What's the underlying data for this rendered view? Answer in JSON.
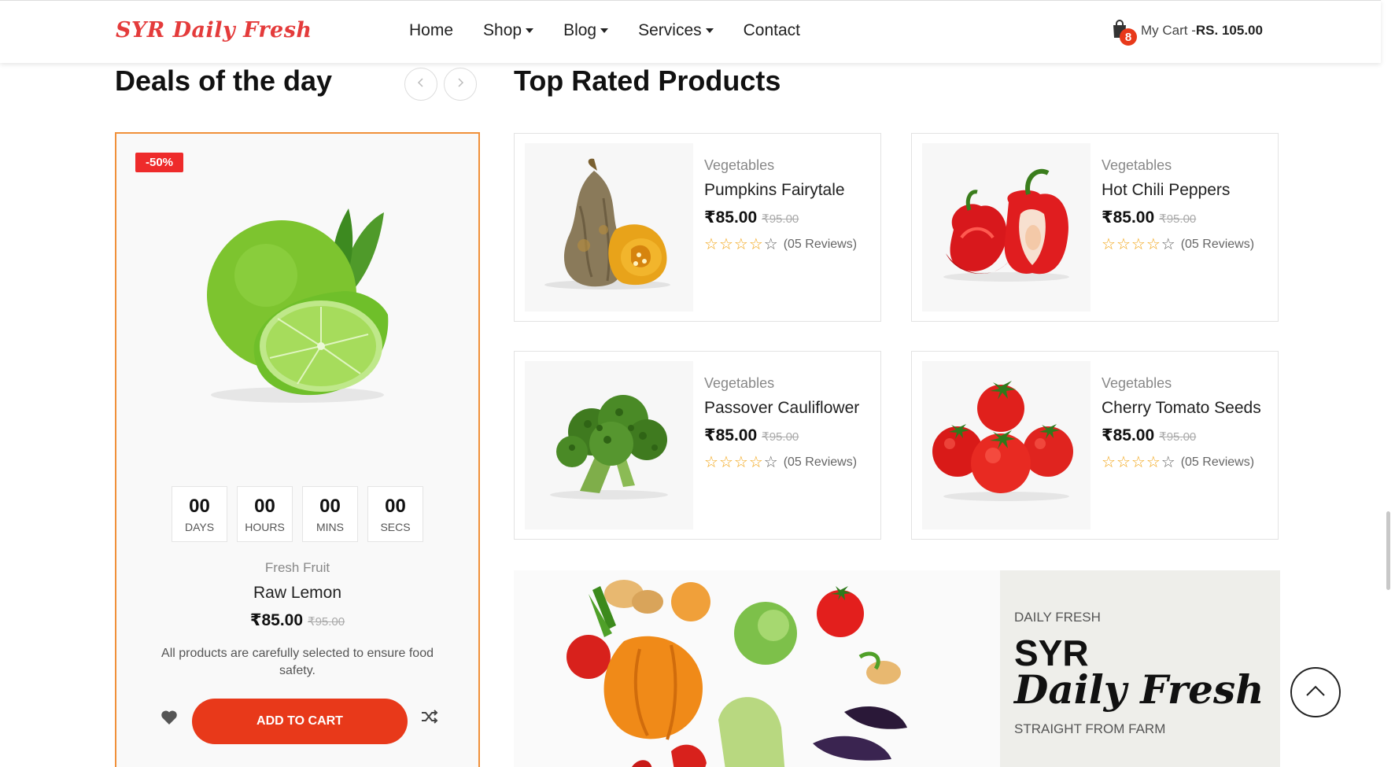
{
  "header": {
    "logo": "SYR Daily Fresh",
    "nav": [
      "Home",
      "Shop",
      "Blog",
      "Services",
      "Contact"
    ],
    "cart": {
      "count": "8",
      "label": "My Cart -",
      "total": "RS. 105.00"
    }
  },
  "deals": {
    "title": "Deals of the day",
    "badge": "-50%",
    "countdown": [
      {
        "value": "00",
        "label": "DAYS"
      },
      {
        "value": "00",
        "label": "HOURS"
      },
      {
        "value": "00",
        "label": "MINS"
      },
      {
        "value": "00",
        "label": "SECS"
      }
    ],
    "category": "Fresh Fruit",
    "name": "Raw Lemon",
    "price": "₹85.00",
    "old_price": "₹95.00",
    "description": "All products are carefully selected to ensure food safety.",
    "add_to_cart": "ADD TO CART"
  },
  "top_rated": {
    "title": "Top Rated Products",
    "products": [
      {
        "category": "Vegetables",
        "name": "Pumpkins Fairytale",
        "price": "₹85.00",
        "old_price": "₹95.00",
        "rating": 4,
        "reviews": "(05 Reviews)",
        "image": "pumpkin"
      },
      {
        "category": "Vegetables",
        "name": "Hot Chili Peppers",
        "price": "₹85.00",
        "old_price": "₹95.00",
        "rating": 4,
        "reviews": "(05 Reviews)",
        "image": "pepper"
      },
      {
        "category": "Vegetables",
        "name": "Passover Cauliflower",
        "price": "₹85.00",
        "old_price": "₹95.00",
        "rating": 4,
        "reviews": "(05 Reviews)",
        "image": "broccoli"
      },
      {
        "category": "Vegetables",
        "name": "Cherry Tomato Seeds",
        "price": "₹85.00",
        "old_price": "₹95.00",
        "rating": 4,
        "reviews": "(05 Reviews)",
        "image": "tomato"
      }
    ]
  },
  "banner": {
    "tag": "DAILY FRESH",
    "title_line1": "SYR",
    "title_line2": "Daily Fresh",
    "subtitle": "STRAIGHT FROM FARM"
  },
  "colors": {
    "accent": "#e8391a",
    "deal_border": "#f0903a",
    "star": "#f2a516",
    "badge": "#ee2b2b"
  }
}
